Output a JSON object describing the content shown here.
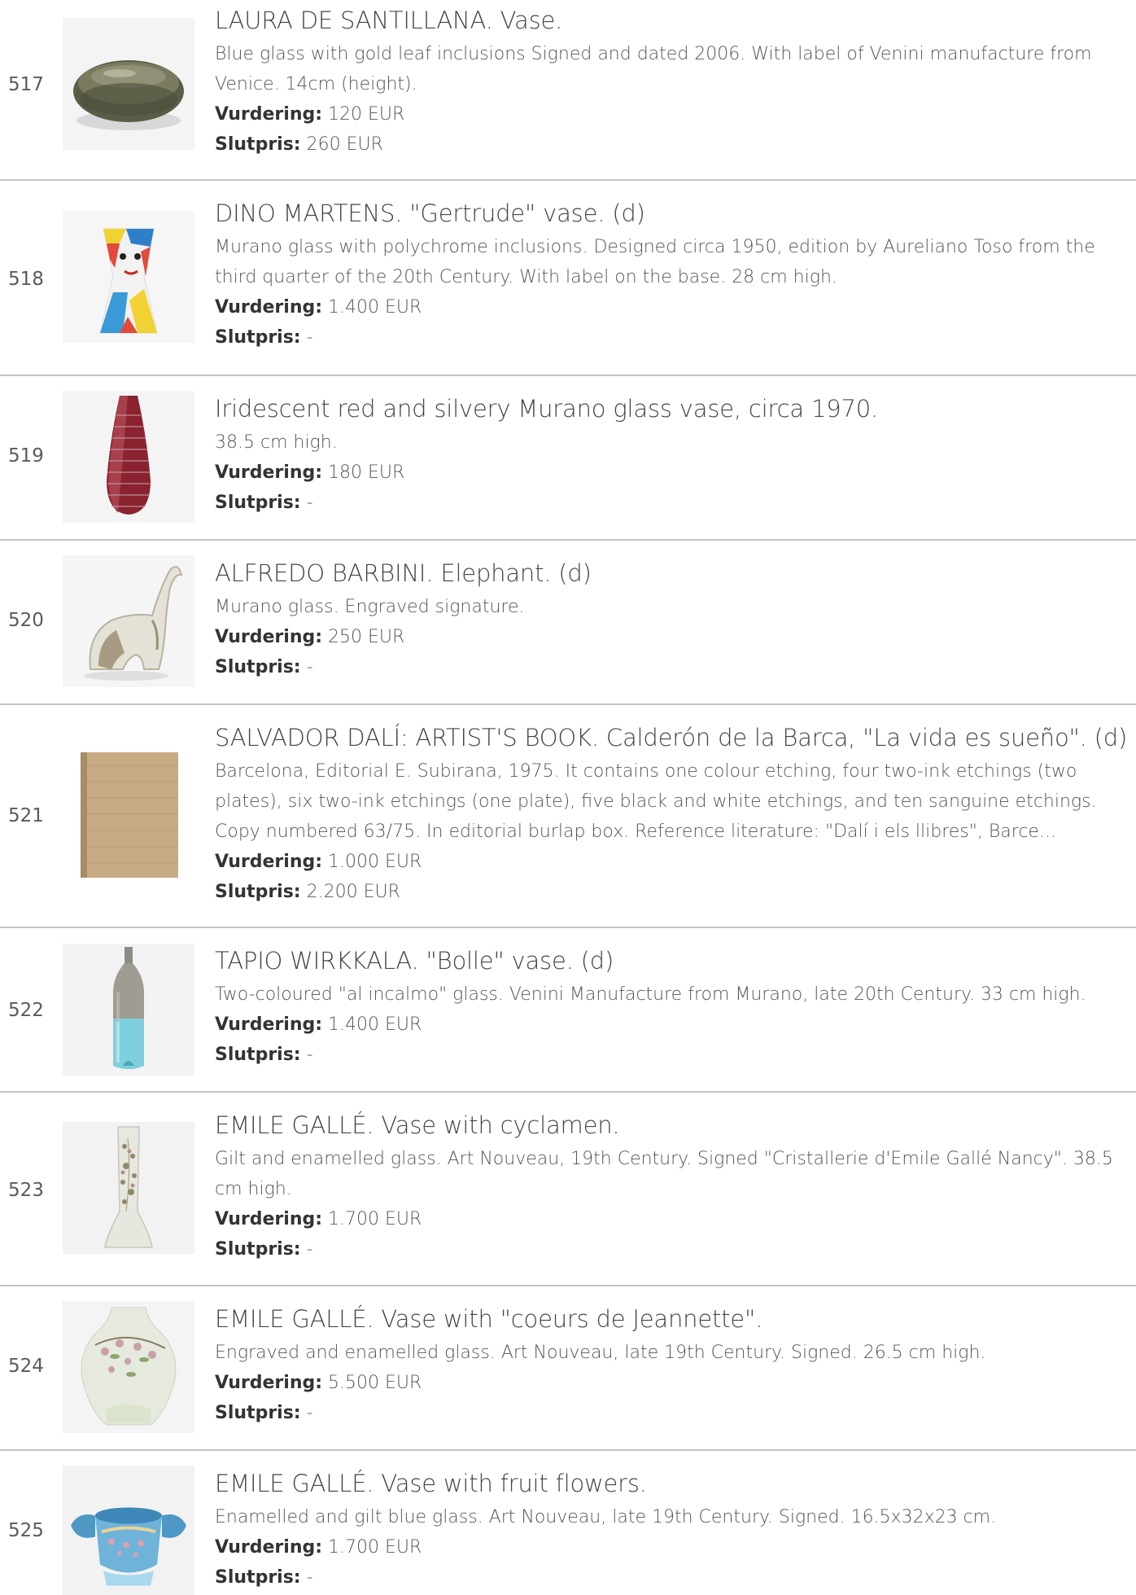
{
  "lots": [
    {
      "number": "517",
      "title": "LAURA DE SANTILLANA. Vase.",
      "description": "Blue glass with gold leaf inclusions Signed and dated 2006. With label of Venini manufacture from Venice. 14cm (height).",
      "estimate_label": "Vurdering:",
      "estimate": "120 EUR",
      "final_label": "Slutpris:",
      "final": "260 EUR",
      "image_icon": "flat-round-vase-image"
    },
    {
      "number": "518",
      "title": "DINO MARTENS. \"Gertrude\" vase. (d)",
      "description": "Murano glass with polychrome inclusions. Designed circa 1950, edition by Aureliano Toso from the third quarter of the 20th Century. With label on the base. 28 cm high.",
      "estimate_label": "Vurdering:",
      "estimate": "1.400 EUR",
      "final_label": "Slutpris:",
      "final": "-",
      "image_icon": "polychrome-face-vase-image"
    },
    {
      "number": "519",
      "title": "Iridescent red and silvery Murano glass vase, circa 1970.",
      "description": "38.5 cm high.",
      "estimate_label": "Vurdering:",
      "estimate": "180 EUR",
      "final_label": "Slutpris:",
      "final": "-",
      "image_icon": "red-ribbed-vase-image"
    },
    {
      "number": "520",
      "title": "ALFREDO BARBINI. Elephant. (d)",
      "description": "Murano glass. Engraved signature.",
      "estimate_label": "Vurdering:",
      "estimate": "250 EUR",
      "final_label": "Slutpris:",
      "final": "-",
      "image_icon": "glass-elephant-image"
    },
    {
      "number": "521",
      "title": "SALVADOR DALÍ: ARTIST'S BOOK. Calderón de la Barca, \"La vida es sueño\". (d)",
      "description": "Barcelona, Editorial E. Subirana, 1975. It contains one colour etching, four two-ink etchings (two plates), six two-ink etchings (one plate), five black and white etchings, and ten sanguine etchings. Copy numbered 63/75. In editorial burlap box. Reference literature: \"Dalí i els llibres\", Barce...",
      "estimate_label": "Vurdering:",
      "estimate": "1.000 EUR",
      "final_label": "Slutpris:",
      "final": "2.200 EUR",
      "image_icon": "burlap-box-image"
    },
    {
      "number": "522",
      "title": "TAPIO WIRKKALA. \"Bolle\" vase. (d)",
      "description": "Two-coloured \"al incalmo\" glass. Venini Manufacture from Murano, late 20th Century. 33 cm high.",
      "estimate_label": "Vurdering:",
      "estimate": "1.400 EUR",
      "final_label": "Slutpris:",
      "final": "-",
      "image_icon": "bottle-vase-image"
    },
    {
      "number": "523",
      "title": "EMILE GALLÉ. Vase with cyclamen.",
      "description": "Gilt and enamelled glass. Art Nouveau, 19th Century. Signed \"Cristallerie d'Emile Gallé Nancy\". 38.5 cm high.",
      "estimate_label": "Vurdering:",
      "estimate": "1.700 EUR",
      "final_label": "Slutpris:",
      "final": "-",
      "image_icon": "tall-enamel-vase-image"
    },
    {
      "number": "524",
      "title": "EMILE GALLÉ. Vase with \"coeurs de Jeannette\".",
      "description": "Engraved and enamelled glass. Art Nouveau, late 19th Century. Signed. 26.5 cm high.",
      "estimate_label": "Vurdering:",
      "estimate": "5.500 EUR",
      "final_label": "Slutpris:",
      "final": "-",
      "image_icon": "frosted-floral-vase-image"
    },
    {
      "number": "525",
      "title": "EMILE GALLÉ. Vase with fruit flowers.",
      "description": "Enamelled and gilt blue glass. Art Nouveau, late 19th Century. Signed. 16.5x32x23 cm.",
      "estimate_label": "Vurdering:",
      "estimate": "1.700 EUR",
      "final_label": "Slutpris:",
      "final": "-",
      "image_icon": "blue-handled-bowl-image"
    }
  ]
}
